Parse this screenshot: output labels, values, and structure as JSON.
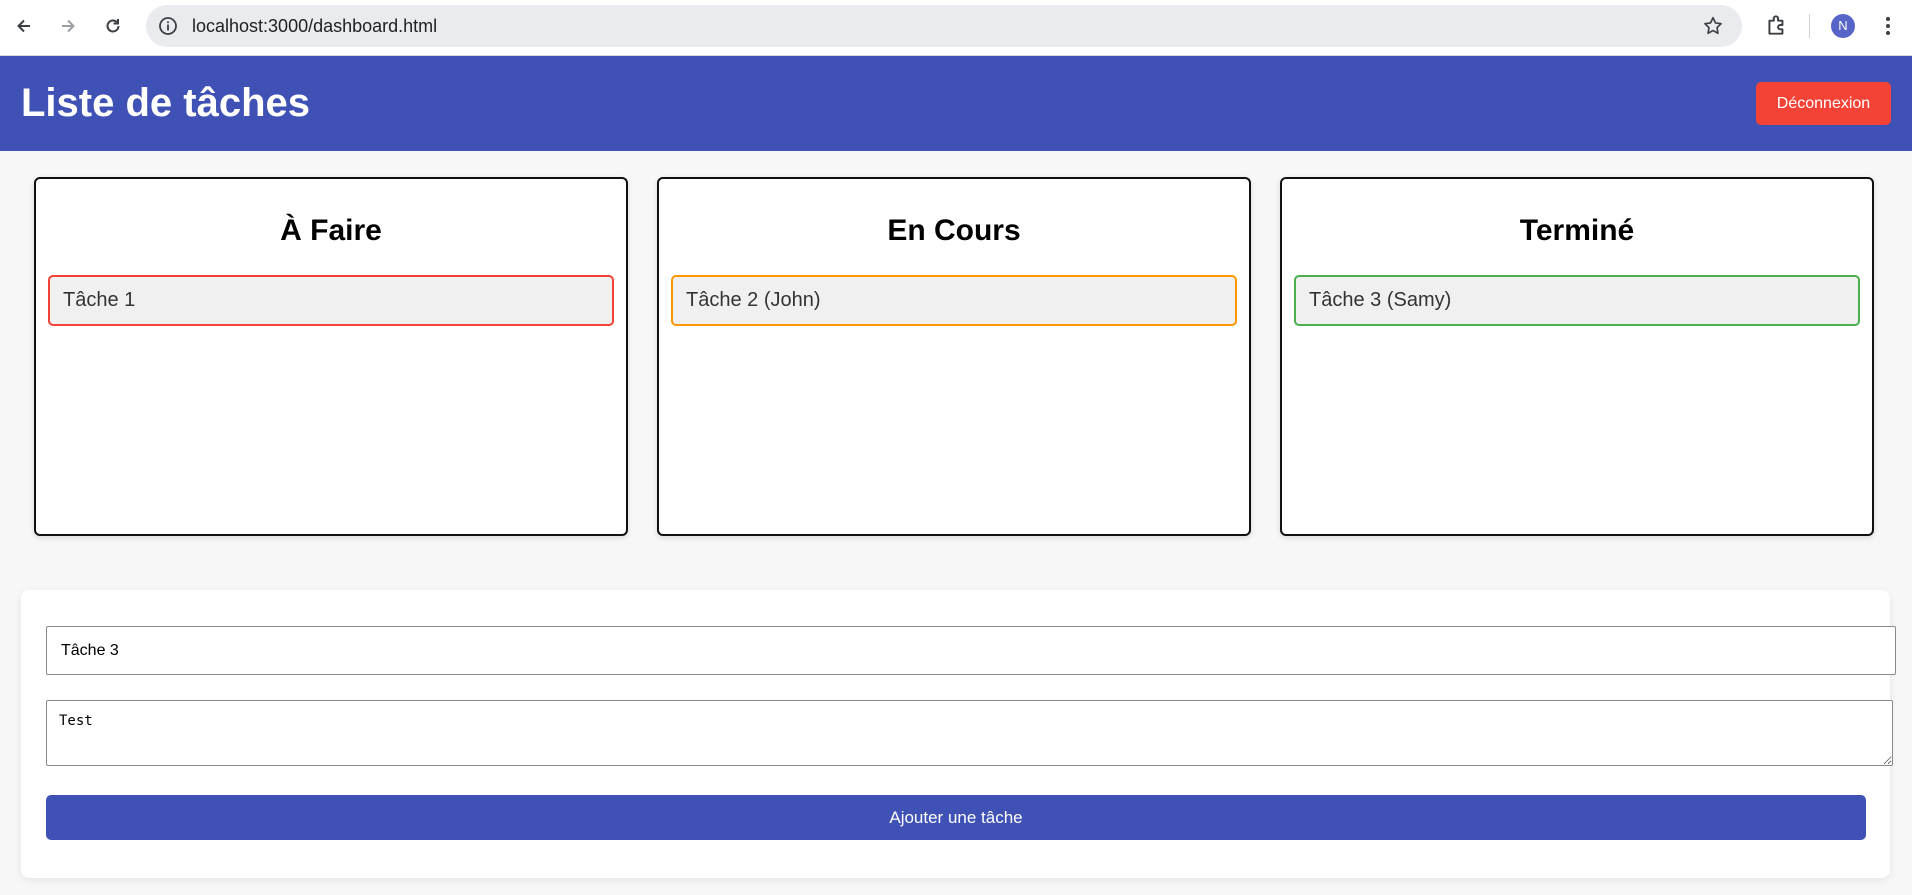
{
  "browser": {
    "url": "localhost:3000/dashboard.html",
    "profile_initial": "N",
    "icons": [
      "back-arrow-icon",
      "forward-arrow-icon",
      "reload-icon",
      "site-info-icon",
      "bookmark-star-icon",
      "extensions-icon",
      "menu-dots-icon"
    ]
  },
  "header": {
    "title": "Liste de tâches",
    "logout_label": "Déconnexion",
    "background": "#3f51b5",
    "logout_color": "#f44336"
  },
  "columns": [
    {
      "title": "À Faire",
      "tasks": [
        {
          "label": "Tâche 1",
          "color": "#f44336"
        }
      ]
    },
    {
      "title": "En Cours",
      "tasks": [
        {
          "label": "Tâche 2 (John)",
          "color": "#ff9800"
        }
      ]
    },
    {
      "title": "Terminé",
      "tasks": [
        {
          "label": "Tâche 3 (Samy)",
          "color": "#4caf50"
        }
      ]
    }
  ],
  "form": {
    "title_value": "Tâche 3",
    "description_value": "Test",
    "submit_label": "Ajouter une tâche"
  }
}
